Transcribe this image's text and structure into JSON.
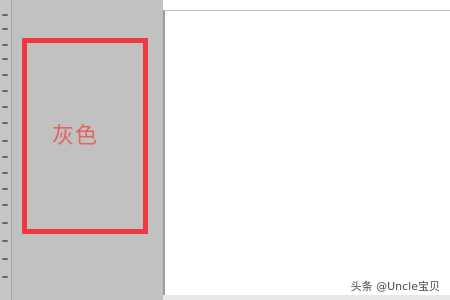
{
  "annotation": {
    "label": "灰色",
    "highlight_color": "#f0393c",
    "label_color": "#e2645e"
  },
  "workspace": {
    "background_color": "#c1c1c1"
  },
  "canvas": {
    "background_color": "#ffffff"
  },
  "watermark": {
    "text": "头条 @Uncle宝贝"
  }
}
